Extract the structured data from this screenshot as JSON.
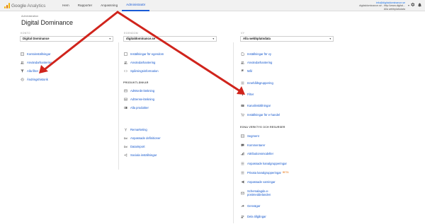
{
  "header": {
    "logo_google": "Google",
    "logo_analytics": "Analytics",
    "nav": [
      "Hem",
      "Rapporter",
      "Anpassning",
      "Administratör"
    ],
    "account_email": "info@digitaldominance.se",
    "account_line2": "digitaldominance.se - http://www.digital...",
    "account_line3": "Alla webbplatsdata"
  },
  "page": {
    "admin_label": "Administration",
    "title": "Digital Dominance"
  },
  "account_col": {
    "heading": "KONTO",
    "selected": "Digital Dominance",
    "items": [
      {
        "icon": "building-icon",
        "label": "Kontoinställningar"
      },
      {
        "icon": "users-icon",
        "label": "Användarhantering"
      },
      {
        "icon": "filter-icon",
        "label": "Alla filter"
      },
      {
        "icon": "history-icon",
        "label": "Ändringshistorik"
      }
    ]
  },
  "property_col": {
    "heading": "EGENDOM",
    "selected": "digitaldominance.se",
    "items": [
      {
        "icon": "square-icon",
        "label": "Inställningar för egendom"
      },
      {
        "icon": "users-icon",
        "label": "Användarhantering"
      },
      {
        "icon": "code-icon",
        "label": "Spårningsinformation"
      }
    ],
    "section_heading": "PRODUKTLÄNKAR",
    "product_items": [
      {
        "icon": "adwords-icon",
        "label": "AdWords-länkning"
      },
      {
        "icon": "adsense-icon",
        "label": "AdSense-länkning"
      },
      {
        "icon": "products-icon",
        "label": "Alla produkter"
      }
    ],
    "more_items": [
      {
        "icon": "remarketing-icon",
        "label": "Remarketing"
      },
      {
        "icon": "dd-icon",
        "label": "Anpassade definitioner"
      },
      {
        "icon": "dd-icon",
        "label": "Dataimport"
      },
      {
        "icon": "social-icon",
        "label": "Sociala inställningar"
      }
    ]
  },
  "view_col": {
    "heading": "VY",
    "selected": "Alla webbplatsdata",
    "items": [
      {
        "icon": "doc-icon",
        "label": "Inställningar för vy"
      },
      {
        "icon": "users-icon",
        "label": "Användarhantering"
      },
      {
        "icon": "flag-icon",
        "label": "Mål"
      },
      {
        "icon": "grouping-icon",
        "label": "Innehållsgruppering"
      },
      {
        "icon": "filter-icon",
        "label": "Filter"
      },
      {
        "icon": "channel-icon",
        "label": "Kanalinställningar"
      },
      {
        "icon": "cart-icon",
        "label": "Inställningar för e-handel"
      }
    ],
    "section_heading": "EGNA VERKTYG OCH RESURSER",
    "tool_items": [
      {
        "icon": "segment-icon",
        "label": "Segment",
        "beta": ""
      },
      {
        "icon": "comment-icon",
        "label": "Kommentarer",
        "beta": ""
      },
      {
        "icon": "attribution-icon",
        "label": "Attributionsmodeller",
        "beta": ""
      },
      {
        "icon": "grouping-icon",
        "label": "Anpassade kanalgrupperingar",
        "beta": ""
      },
      {
        "icon": "grouping-icon",
        "label": "Privata kanalgrupperingar",
        "beta": "BETA"
      },
      {
        "icon": "alert-icon",
        "label": "Anpassade varningar",
        "beta": ""
      },
      {
        "icon": "email-icon",
        "label": "Schemalagda e-postmeddelanden",
        "beta": ""
      },
      {
        "icon": "shortcut-icon",
        "label": "Genvägar",
        "beta": ""
      },
      {
        "icon": "share-icon",
        "label": "Dela tillgångar",
        "beta": ""
      }
    ]
  },
  "colors": {
    "accent": "#1a5bd6",
    "link": "#1155cc",
    "arrow": "#d0241c"
  }
}
